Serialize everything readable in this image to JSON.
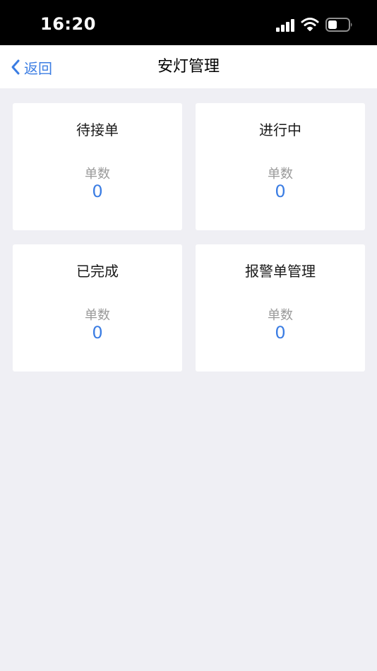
{
  "status_bar": {
    "time": "16:20"
  },
  "nav": {
    "back_label": "返回",
    "title": "安灯管理"
  },
  "cards": [
    {
      "title": "待接单",
      "count_label": "单数",
      "count": "0"
    },
    {
      "title": "进行中",
      "count_label": "单数",
      "count": "0"
    },
    {
      "title": "已完成",
      "count_label": "单数",
      "count": "0"
    },
    {
      "title": "报警单管理",
      "count_label": "单数",
      "count": "0"
    }
  ],
  "colors": {
    "accent": "#3b7de3",
    "background": "#efeff4",
    "card": "#ffffff"
  },
  "icons": [
    "signal-icon",
    "wifi-icon",
    "battery-icon",
    "chevron-left-icon"
  ]
}
